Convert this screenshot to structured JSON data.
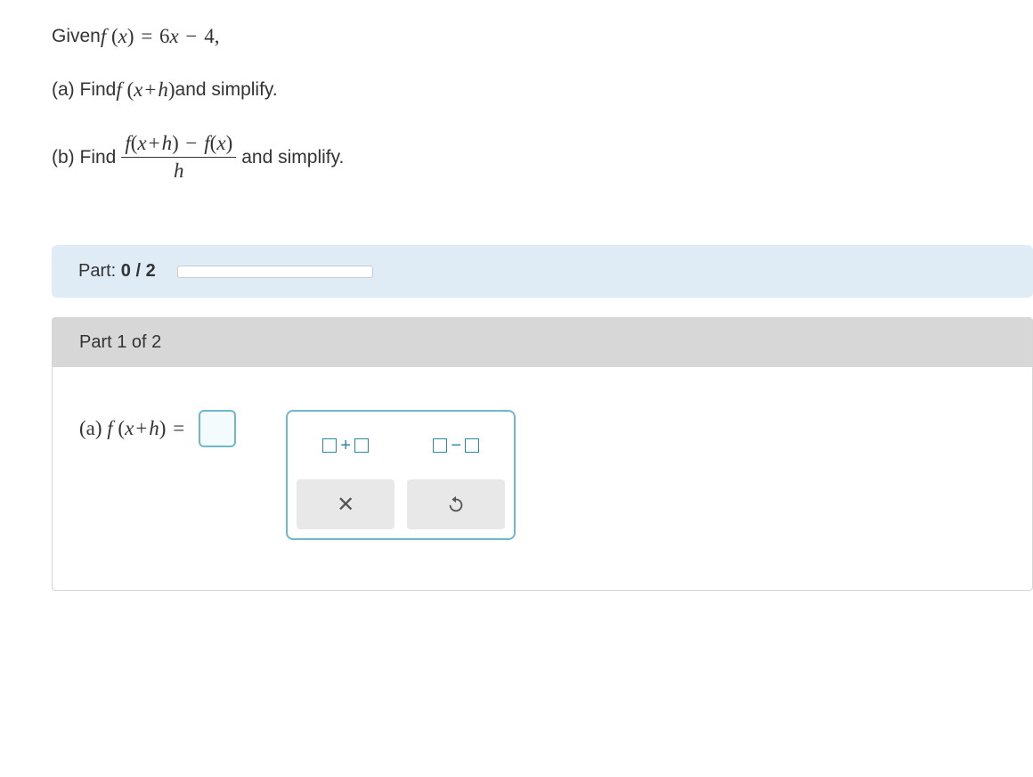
{
  "given_prefix": "Given ",
  "f_def": {
    "f": "f",
    "x": "x",
    "eq": "=",
    "a": "6",
    "xvar": "x",
    "minus": "−",
    "b": "4",
    "comma": ","
  },
  "part_a": {
    "label": "(a) Find ",
    "f": "f",
    "arg_l": "x",
    "plus": "+",
    "arg_r": "h",
    "suffix": " and simplify."
  },
  "part_b": {
    "label": "(b) Find ",
    "num": {
      "f1": "f",
      "l1": "x",
      "p1": "+",
      "r1": "h",
      "m": "−",
      "f2": "f",
      "l2": "x"
    },
    "den": "h",
    "suffix": " and simplify."
  },
  "progress": {
    "label_prefix": "Part: ",
    "done": "0",
    "sep": " / ",
    "total": "2",
    "percent": 0
  },
  "part1": {
    "header": "Part 1 of 2",
    "prompt_label": "(a) ",
    "f": "f",
    "arg_l": "x",
    "plus": "+",
    "arg_r": "h",
    "eq": "="
  },
  "palette": {
    "plus": "+",
    "minus": "−"
  }
}
